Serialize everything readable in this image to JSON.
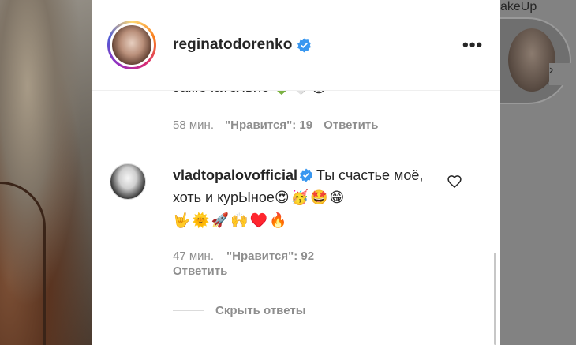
{
  "header": {
    "username": "reginatodorenko",
    "more_label": "•••"
  },
  "previous_comment": {
    "text_tail": "замечательно",
    "emojis": "💚🤍😍",
    "time": "58 мин.",
    "likes": "\"Нравится\": 19",
    "reply_label": "Ответить"
  },
  "reply": {
    "username": "vladtopalovofficial",
    "text": "Ты счастье моё, хоть и курЫное",
    "emojis_line1": "😍🥳🤩😁",
    "emojis_line2": "🤟🌞🚀🙌♥️🔥",
    "time": "47 мин.",
    "likes": "\"Нравится\": 92",
    "reply_label": "Ответить"
  },
  "hide_replies_label": "Скрыть ответы",
  "background": {
    "right_caption": "akeUp",
    "next_arrow": "›"
  },
  "colors": {
    "verified_blue": "#3897f0",
    "muted_text": "#8e8e8e",
    "overlay": "#8a8a8a"
  },
  "icons": [
    "verified-badge-icon",
    "more-options-icon",
    "heart-outline-icon",
    "chevron-right-icon"
  ]
}
